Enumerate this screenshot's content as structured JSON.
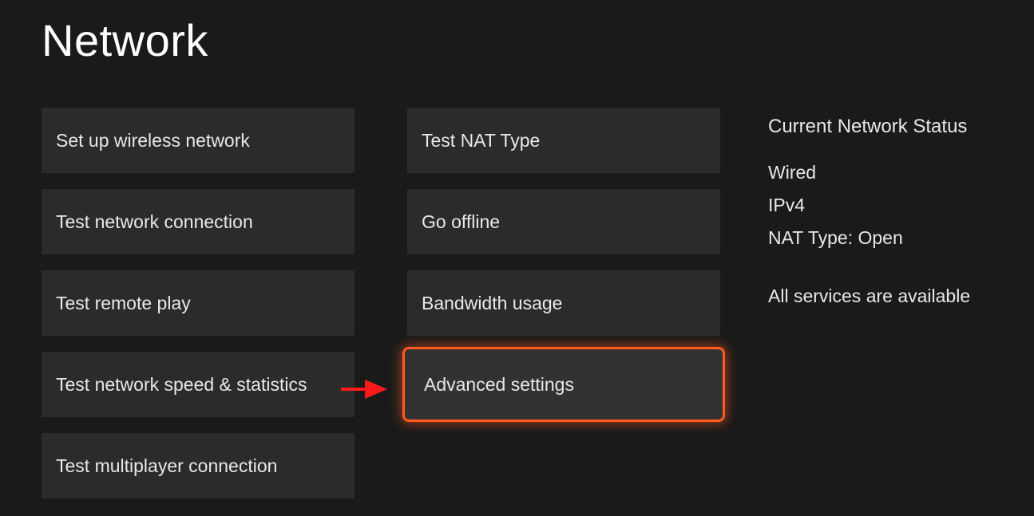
{
  "title": "Network",
  "columns": {
    "left": [
      {
        "id": "setup-wireless",
        "label": "Set up wireless network"
      },
      {
        "id": "test-connection",
        "label": "Test network connection"
      },
      {
        "id": "test-remote-play",
        "label": "Test remote play"
      },
      {
        "id": "test-speed",
        "label": "Test network speed & statistics"
      },
      {
        "id": "test-multiplayer",
        "label": "Test multiplayer connection"
      }
    ],
    "right": [
      {
        "id": "test-nat",
        "label": "Test NAT Type"
      },
      {
        "id": "go-offline",
        "label": "Go offline"
      },
      {
        "id": "bandwidth",
        "label": "Bandwidth usage"
      },
      {
        "id": "advanced",
        "label": "Advanced settings",
        "highlighted": true
      }
    ]
  },
  "status": {
    "heading": "Current Network Status",
    "lines": [
      "Wired",
      "IPv4",
      "NAT Type: Open"
    ],
    "services": "All services are available"
  },
  "annotation": {
    "arrow_color": "#ff1a1a"
  }
}
